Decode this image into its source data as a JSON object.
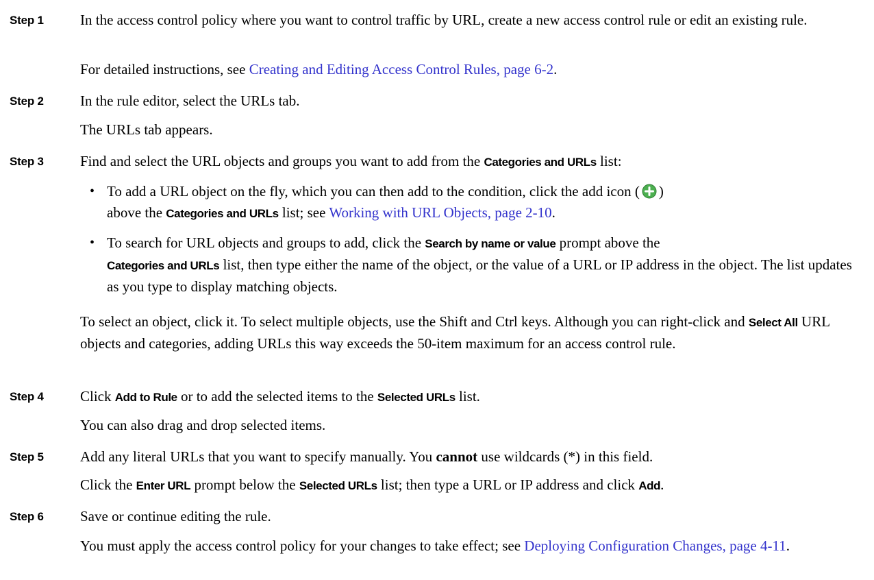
{
  "steps": [
    {
      "label": "Step 1",
      "text_a": "In the access control policy where you want to control traffic by URL, create a new access control rule or edit an existing rule.",
      "sub_prefix": "For detailed instructions, see ",
      "sub_link": "Creating and Editing Access Control Rules, page 6-2",
      "sub_suffix": "."
    },
    {
      "label": "Step 2",
      "text": "In the rule editor, select the URLs tab.",
      "sub": "The URLs tab appears."
    },
    {
      "label": "Step 3",
      "text_prefix": "Find and select the URL objects and groups you want to add from the ",
      "text_ui": "Categories and URLs",
      "text_suffix": " list:",
      "bullet1_a": "To add a URL object on the fly, which you can then add to the condition, click the add icon (",
      "bullet1_b": ")",
      "bullet1_c": "above the ",
      "bullet1_ui": "Categories and URLs",
      "bullet1_d": " list; see ",
      "bullet1_link": "Working with URL Objects, page 2-10",
      "bullet1_e": ".",
      "bullet2_a": "To search for URL objects and groups to add, click the ",
      "bullet2_ui1": "Search by name or value",
      "bullet2_b": " prompt above the",
      "bullet2_ui2": "Categories and URLs",
      "bullet2_c": " list, then type either the name of the object, or the value of a URL or IP address in the object. The list updates as you type to display matching objects.",
      "note_a": "To select an object, click it. To select multiple objects, use the Shift and Ctrl keys. Although you can right-click and ",
      "note_ui": "Select All",
      "note_b": " URL objects and categories, adding URLs this way exceeds the 50-item maximum for an access control rule."
    },
    {
      "label": "Step 4",
      "text_a": "Click ",
      "text_ui1": "Add to Rule",
      "text_b": " or to add the selected items to the ",
      "text_ui2": "Selected URLs",
      "text_c": " list.",
      "sub": "You can also drag and drop selected items."
    },
    {
      "label": "Step 5",
      "text_a": "Add any literal URLs that you want to specify manually. You ",
      "text_strong": "cannot",
      "text_b": " use wildcards (*) in this field.",
      "sub_a": "Click the ",
      "sub_ui1": "Enter URL",
      "sub_b": " prompt below the ",
      "sub_ui2": "Selected URLs",
      "sub_c": " list; then type a URL or IP address and click ",
      "sub_ui3": "Add",
      "sub_d": "."
    },
    {
      "label": "Step 6",
      "text": "Save or continue editing the rule.",
      "sub_a": "You must apply the access control policy for your changes to take effect; see ",
      "sub_link": "Deploying Configuration Changes, page 4-11",
      "sub_b": "."
    }
  ],
  "colors": {
    "link": "#3333cc",
    "add_icon": "#4caf50"
  },
  "icons": {
    "add": "add-icon"
  }
}
